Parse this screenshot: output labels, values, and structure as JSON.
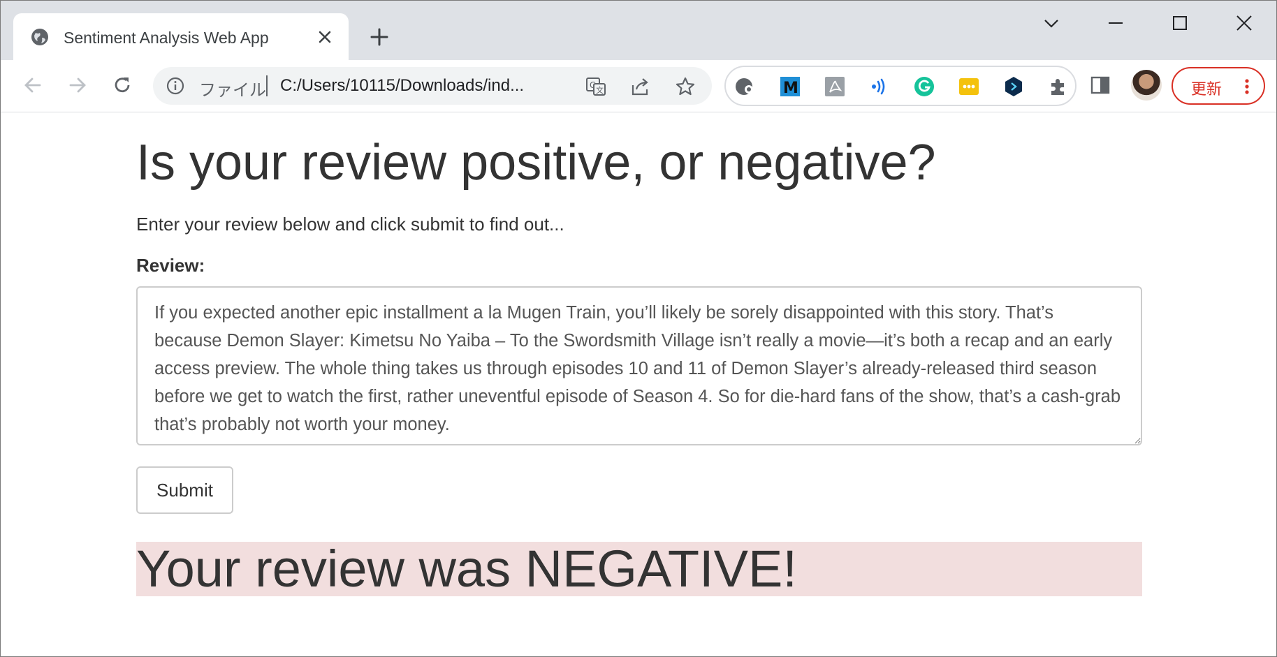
{
  "browser": {
    "tab": {
      "title": "Sentiment Analysis Web App"
    },
    "address": {
      "label": "ファイル",
      "url": "C:/Users/10115/Downloads/ind..."
    },
    "update_button": {
      "label": "更新"
    }
  },
  "page": {
    "title": "Is your review positive, or negative?",
    "lead": "Enter your review below and click submit to find out...",
    "review_label": "Review:",
    "review_text": "If you expected another epic installment a la Mugen Train, you’ll likely be sorely disappointed with this story. That’s because Demon Slayer: Kimetsu No Yaiba – To the Swordsmith Village isn’t really a movie—it’s both a recap and an early access preview. The whole thing takes us through episodes 10 and 11 of Demon Slayer’s already-released third season before we get to watch the first, rather uneventful episode of Season 4. So for die-hard fans of the show, that’s a cash-grab that’s probably not worth your money.",
    "submit_label": "Submit",
    "result_text": "Your review was NEGATIVE!"
  },
  "colors": {
    "result_background": "#f2dede",
    "update_accent": "#d93025",
    "tabstrip": "#dee1e6"
  }
}
